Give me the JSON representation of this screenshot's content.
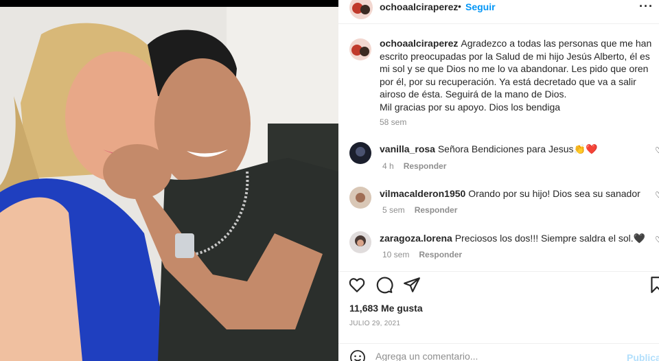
{
  "post": {
    "author": "ochoaalciraperez",
    "separator": "•",
    "follow_label": "Seguir",
    "more_label": "···",
    "caption": "Agradezco a todas las personas que me han escrito preocupadas por la Salud de mi hijo Jesús Alberto, él es mi sol y se que Dios no me lo va abandonar. Les pido que oren por él, por su recuperación. Ya está decretado que va a salir airoso de ésta. Seguirá de la mano de Dios.\nMil gracias por su apoyo. Dios los bendiga",
    "caption_time": "58 sem",
    "likes": "11,683 Me gusta",
    "date": "JULIO 29, 2021"
  },
  "comments": [
    {
      "user": "vanilla_rosa",
      "text": "Señora Bendiciones para Jesus👏❤️",
      "time": "4 h",
      "reply": "Responder"
    },
    {
      "user": "vilmacalderon1950",
      "text": "Orando por su hijo! Dios sea su sanador",
      "time": "5 sem",
      "reply": "Responder"
    },
    {
      "user": "zaragoza.lorena",
      "text": "Preciosos los dos!!! Siempre saldra el sol.🖤",
      "time": "10 sem",
      "reply": "Responder"
    }
  ],
  "comment_box": {
    "placeholder": "Agrega un comentario...",
    "publish_label": "Publicar"
  },
  "icons": {
    "like": "heart-outline-icon",
    "comment": "comment-bubble-icon",
    "share": "paper-plane-icon",
    "save": "bookmark-icon",
    "emoji": "emoji-icon",
    "comment_like": "heart-small-icon"
  },
  "colors": {
    "accent": "#0095f6",
    "muted": "#8e8e8e",
    "publish_disabled": "#b2dffc"
  }
}
